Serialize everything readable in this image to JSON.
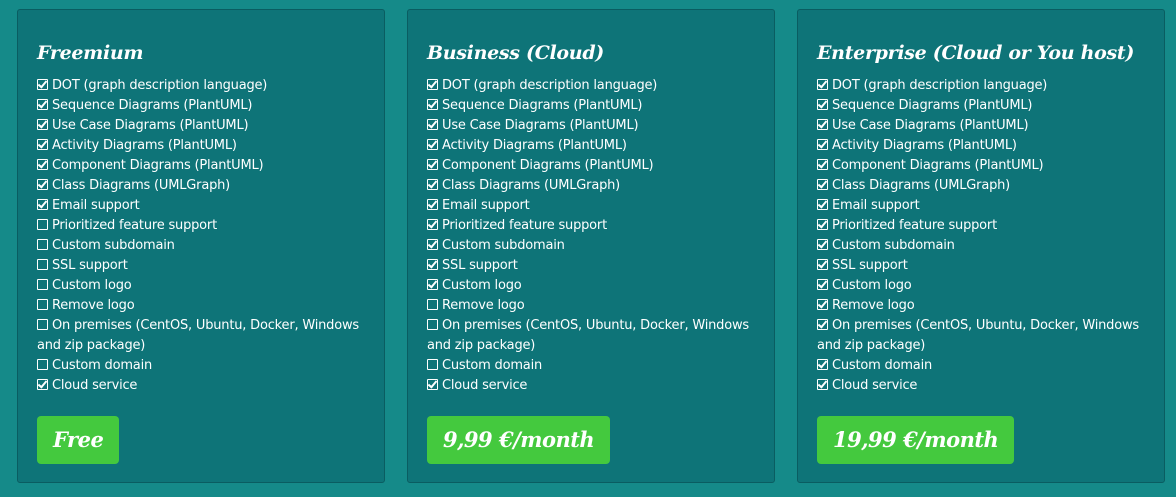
{
  "plans": [
    {
      "title": "Freemium",
      "price_label": "Free",
      "features": [
        {
          "label": "DOT (graph description language)",
          "checked": true
        },
        {
          "label": "Sequence Diagrams (PlantUML)",
          "checked": true
        },
        {
          "label": "Use Case Diagrams (PlantUML)",
          "checked": true
        },
        {
          "label": "Activity Diagrams (PlantUML)",
          "checked": true
        },
        {
          "label": "Component Diagrams (PlantUML)",
          "checked": true
        },
        {
          "label": "Class Diagrams (UMLGraph)",
          "checked": true
        },
        {
          "label": "Email support",
          "checked": true
        },
        {
          "label": "Prioritized feature support",
          "checked": false
        },
        {
          "label": "Custom subdomain",
          "checked": false
        },
        {
          "label": "SSL support",
          "checked": false
        },
        {
          "label": "Custom logo",
          "checked": false
        },
        {
          "label": "Remove logo",
          "checked": false
        },
        {
          "label": "On premises (CentOS, Ubuntu, Docker, Windows and zip package)",
          "checked": false
        },
        {
          "label": "Custom domain",
          "checked": false
        },
        {
          "label": "Cloud service",
          "checked": true
        }
      ]
    },
    {
      "title": "Business (Cloud)",
      "price_label": "9,99 €/month",
      "features": [
        {
          "label": "DOT (graph description language)",
          "checked": true
        },
        {
          "label": "Sequence Diagrams (PlantUML)",
          "checked": true
        },
        {
          "label": "Use Case Diagrams (PlantUML)",
          "checked": true
        },
        {
          "label": "Activity Diagrams (PlantUML)",
          "checked": true
        },
        {
          "label": "Component Diagrams (PlantUML)",
          "checked": true
        },
        {
          "label": "Class Diagrams (UMLGraph)",
          "checked": true
        },
        {
          "label": "Email support",
          "checked": true
        },
        {
          "label": "Prioritized feature support",
          "checked": true
        },
        {
          "label": "Custom subdomain",
          "checked": true
        },
        {
          "label": "SSL support",
          "checked": true
        },
        {
          "label": "Custom logo",
          "checked": true
        },
        {
          "label": "Remove logo",
          "checked": false
        },
        {
          "label": "On premises (CentOS, Ubuntu, Docker, Windows and zip package)",
          "checked": false
        },
        {
          "label": "Custom domain",
          "checked": false
        },
        {
          "label": "Cloud service",
          "checked": true
        }
      ]
    },
    {
      "title": "Enterprise (Cloud or You host)",
      "price_label": "19,99 €/month",
      "features": [
        {
          "label": "DOT (graph description language)",
          "checked": true
        },
        {
          "label": "Sequence Diagrams (PlantUML)",
          "checked": true
        },
        {
          "label": "Use Case Diagrams (PlantUML)",
          "checked": true
        },
        {
          "label": "Activity Diagrams (PlantUML)",
          "checked": true
        },
        {
          "label": "Component Diagrams (PlantUML)",
          "checked": true
        },
        {
          "label": "Class Diagrams (UMLGraph)",
          "checked": true
        },
        {
          "label": "Email support",
          "checked": true
        },
        {
          "label": "Prioritized feature support",
          "checked": true
        },
        {
          "label": "Custom subdomain",
          "checked": true
        },
        {
          "label": "SSL support",
          "checked": true
        },
        {
          "label": "Custom logo",
          "checked": true
        },
        {
          "label": "Remove logo",
          "checked": true
        },
        {
          "label": "On premises (CentOS, Ubuntu, Docker, Windows and zip package)",
          "checked": true
        },
        {
          "label": "Custom domain",
          "checked": true
        },
        {
          "label": "Cloud service",
          "checked": true
        }
      ]
    }
  ],
  "colors": {
    "page_background": "#158a89",
    "card_background": "#0e7478",
    "button_green": "#44c93e",
    "text": "#ffffff"
  },
  "icons": {
    "checked": "checkbox-checked-icon",
    "unchecked": "checkbox-empty-icon"
  }
}
